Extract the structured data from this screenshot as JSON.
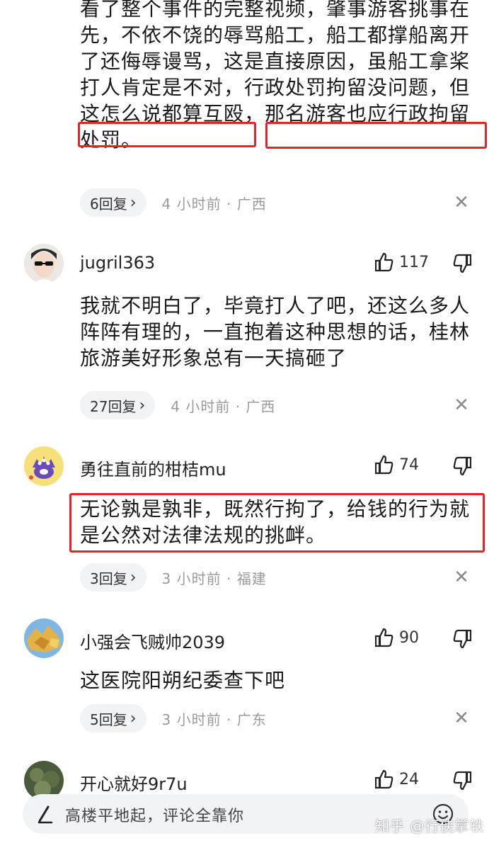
{
  "colors": {
    "highlight_box": "#e3242b",
    "pill_bg": "#f2f3f5",
    "meta_gray": "#9a9a9a"
  },
  "comment0": {
    "text_lines": [
      "看了整个事件的完整视频，肇事游客挑事在",
      "先，不依不饶的辱骂船工，船工都撑船离开",
      "了还侮辱谩骂，这是直接原因，虽船工拿桨",
      "打人肯定是不对，行政处罚拘留没问题，但",
      "这怎么说都算互殴，那名游客也应行政拘留",
      "处罚。"
    ],
    "reply_label": "6回复",
    "meta": "4 小时前 · 广西"
  },
  "comment1": {
    "username": "jugril363",
    "likes": "117",
    "text_lines": [
      "我就不明白了，毕竟打人了吧，还这么多人",
      "阵阵有理的，一直抱着这种思想的话，桂林",
      "旅游美好形象总有一天搞砸了"
    ],
    "reply_label": "27回复",
    "meta": "4 小时前 · 广西"
  },
  "comment2": {
    "username": "勇往直前的柑桔mu",
    "likes": "74",
    "text_lines": [
      "无论孰是孰非，既然行拘了，给钱的行为就",
      "是公然对法律法规的挑衅。"
    ],
    "reply_label": "3回复",
    "meta": "3 小时前 · 福建"
  },
  "comment3": {
    "username": "小强会飞贼帅2039",
    "likes": "90",
    "text_lines": [
      "这医院阳朔纪委查下吧"
    ],
    "reply_label": "5回复",
    "meta": "3 小时前 · 广东"
  },
  "comment4": {
    "username": "开心就好9r7u",
    "likes": "24"
  },
  "bottom_bar": {
    "placeholder": "高楼平地起，评论全靠你"
  },
  "watermark": "知乎 @行侠掌轶"
}
